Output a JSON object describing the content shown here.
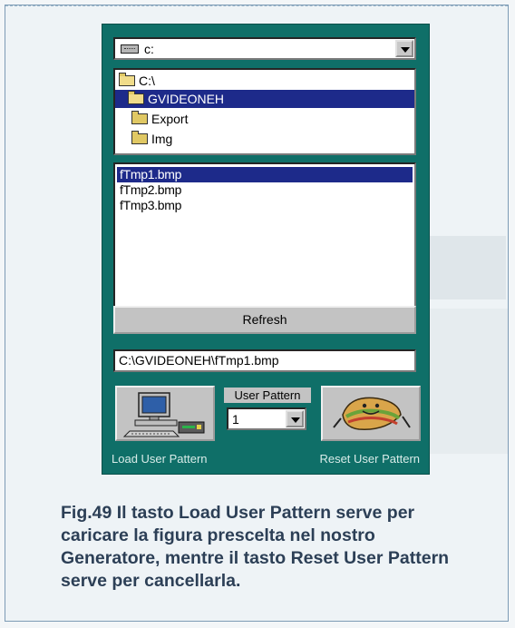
{
  "drive_combo": {
    "label": "c:",
    "icon": "drive-icon"
  },
  "directories": [
    {
      "label": "C:\\",
      "icon": "open-folder-icon",
      "selected": false
    },
    {
      "label": "GVIDEONEH",
      "icon": "open-folder-icon",
      "selected": true
    },
    {
      "label": "Export",
      "icon": "folder-icon",
      "selected": false
    },
    {
      "label": "Img",
      "icon": "folder-icon",
      "selected": false
    }
  ],
  "files": [
    {
      "label": "fTmp1.bmp",
      "selected": true
    },
    {
      "label": "fTmp2.bmp",
      "selected": false
    },
    {
      "label": "fTmp3.bmp",
      "selected": false
    }
  ],
  "refresh_label": "Refresh",
  "path_value": "C:\\GVIDEONEH\\fTmp1.bmp",
  "user_pattern": {
    "label": "User Pattern",
    "value": "1"
  },
  "load_button": {
    "caption": "Load User Pattern",
    "icon": "computer-icon"
  },
  "reset_button": {
    "caption": "Reset User Pattern",
    "icon": "sandwich-icon"
  },
  "figure_caption": "Fig.49 Il tasto Load User Pattern serve per caricare la figura prescelta nel nostro Generatore, mentre il tasto Reset User Pattern serve per cancellarla.",
  "colors": {
    "panel": "#0f6f68",
    "selection": "#1d2a8a",
    "caption_text": "#2c3f56"
  }
}
